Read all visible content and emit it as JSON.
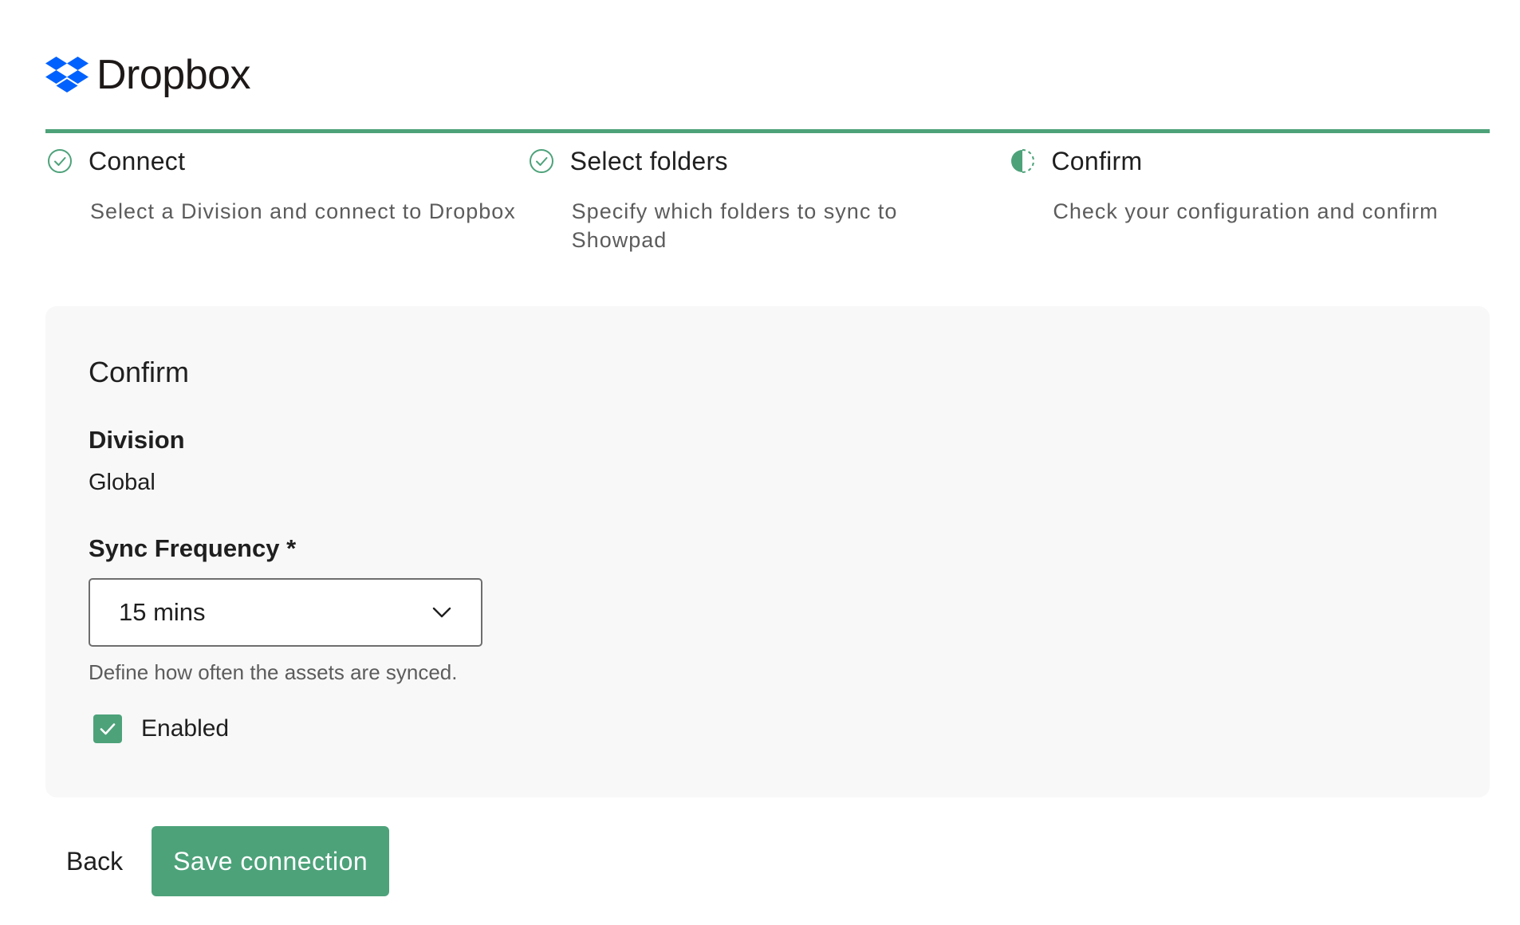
{
  "brand": {
    "name": "Dropbox",
    "logo_icon": "dropbox-logo-icon",
    "logo_color": "#0061fe"
  },
  "colors": {
    "accent": "#4da27a",
    "panel_background": "#f8f8f8",
    "muted_text": "#5c5c5c"
  },
  "stepper": {
    "steps": [
      {
        "title": "Connect",
        "description": "Select a Division and connect to Dropbox",
        "status": "complete",
        "icon": "check-circle-icon"
      },
      {
        "title": "Select folders",
        "description": "Specify which folders to sync to Showpad",
        "status": "complete",
        "icon": "check-circle-icon"
      },
      {
        "title": "Confirm",
        "description": "Check your configuration and confirm",
        "status": "in-progress",
        "icon": "half-circle-progress-icon"
      }
    ]
  },
  "confirm_panel": {
    "title": "Confirm",
    "division": {
      "label": "Division",
      "value": "Global"
    },
    "sync_frequency": {
      "label": "Sync Frequency *",
      "selected": "15 mins",
      "help_text": "Define how often the assets are synced."
    },
    "enabled": {
      "label": "Enabled",
      "checked": true
    }
  },
  "actions": {
    "back_label": "Back",
    "save_label": "Save connection"
  }
}
